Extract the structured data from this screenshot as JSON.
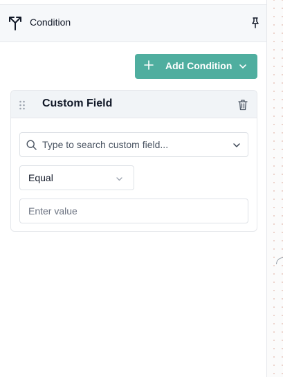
{
  "panel": {
    "title": "Condition",
    "icons": {
      "header": "branch-split-icon",
      "pin": "pin-icon"
    }
  },
  "toolbar": {
    "add_condition_label": "Add Condition",
    "accent_color": "#4fae9f"
  },
  "condition_card": {
    "title": "Custom Field",
    "field_search": {
      "placeholder": "Type to search custom field..."
    },
    "operator": {
      "selected": "Equal"
    },
    "value": {
      "placeholder": "Enter value",
      "current": ""
    }
  }
}
